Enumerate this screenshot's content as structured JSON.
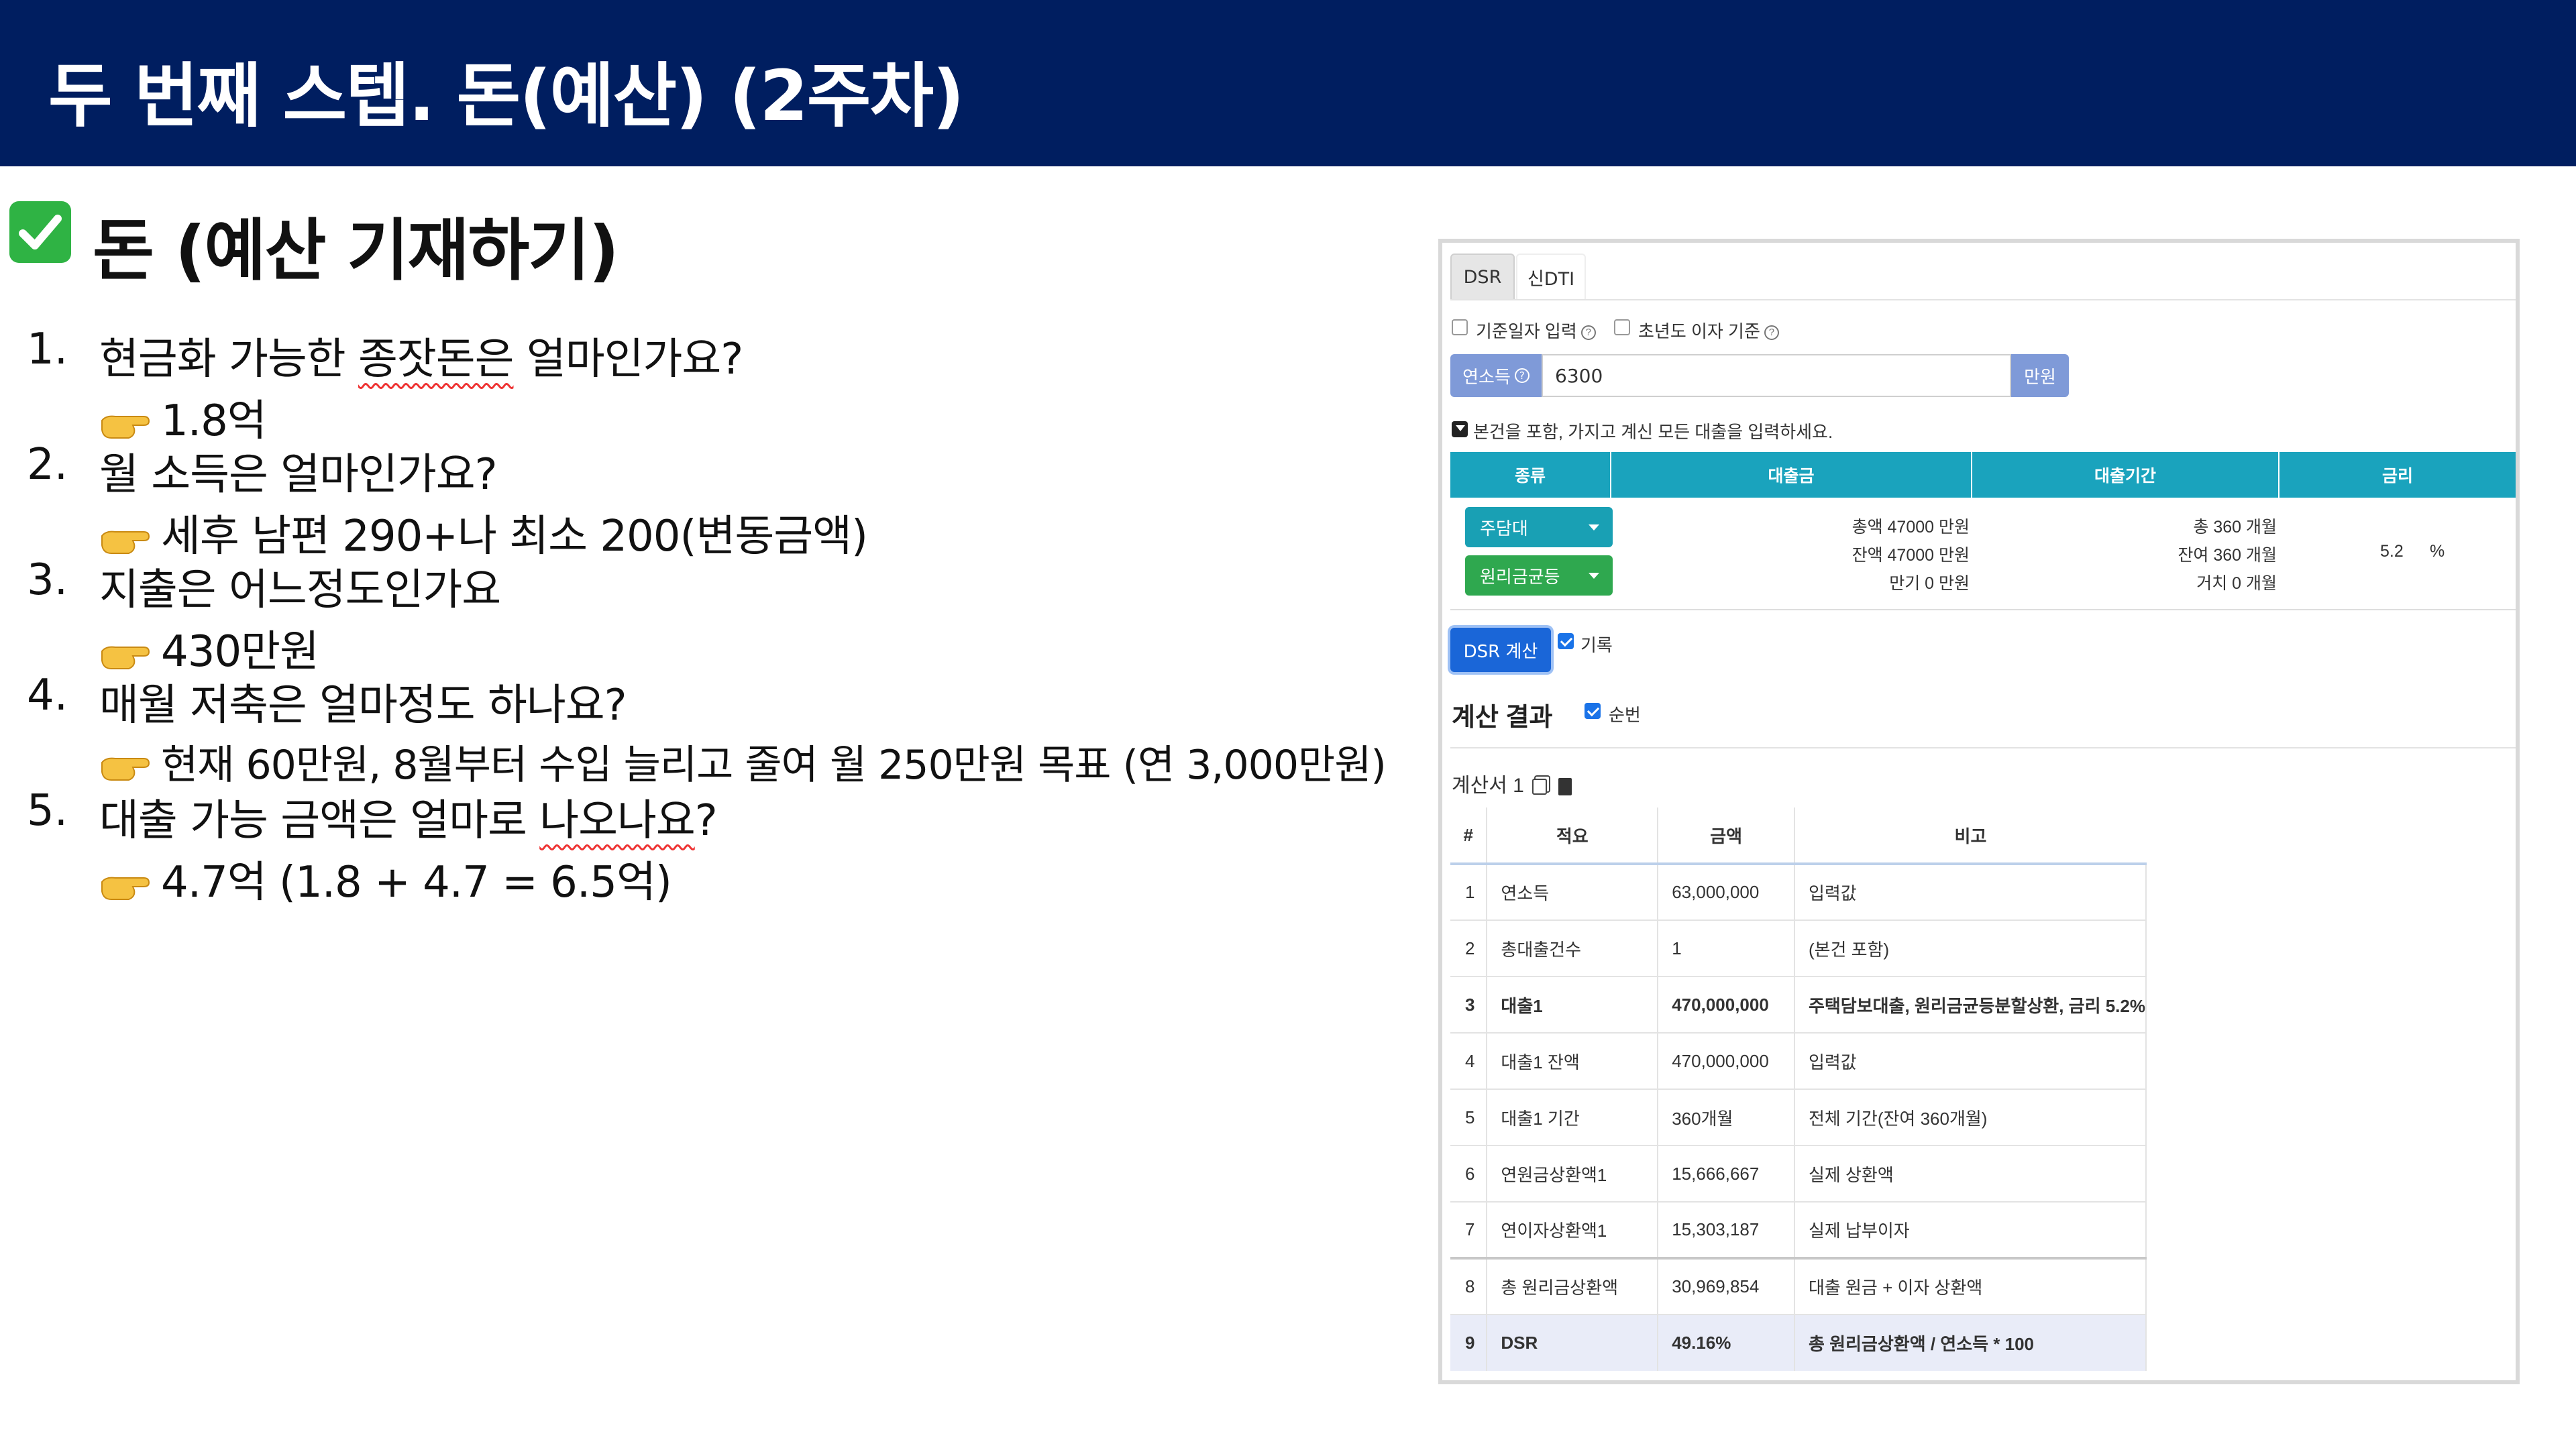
{
  "header": {
    "title": "두 번째 스텝. 돈(예산) (2주차)"
  },
  "section": {
    "title": "돈 (예산 기재하기)",
    "icon": "check-mark-icon"
  },
  "questions": [
    {
      "num": "1.",
      "text_before": "현금화 가능한 ",
      "text_underlined": "종잣돈은",
      "text_after": " 얼마인가요?",
      "answer": "1.8억"
    },
    {
      "num": "2.",
      "text_before": "월 소득은 얼마인가요?",
      "text_underlined": "",
      "text_after": "",
      "answer": "세후 남편 290+나 최소 200(변동금액)"
    },
    {
      "num": "3.",
      "text_before": "지출은 어느정도인가요",
      "text_underlined": "",
      "text_after": "",
      "answer": "430만원"
    },
    {
      "num": "4.",
      "text_before": "매월 저축은 얼마정도 하나요?",
      "text_underlined": "",
      "text_after": "",
      "answer": "현재 60만원, 8월부터 수입 늘리고 줄여 월 250만원 목표 (연 3,000만원)"
    },
    {
      "num": "5.",
      "text_before": "대출 가능 금액은 얼마로 ",
      "text_underlined": "나오나요",
      "text_after": "?",
      "answer": "4.7억 (1.8 + 4.7 = 6.5억)"
    }
  ],
  "calc": {
    "tabs": [
      "DSR",
      "신DTI"
    ],
    "options": {
      "base_date": "기준일자 입력",
      "first_year_interest": "초년도 이자 기준"
    },
    "income": {
      "label": "연소득",
      "value": "6300",
      "unit": "만원"
    },
    "notice": "본건을 포함, 가지고 계신 모든 대출을 입력하세요.",
    "loan_headers": [
      "종류",
      "대출금",
      "대출기간",
      "금리"
    ],
    "loan": {
      "type": "주담대",
      "repayment": "원리금균등",
      "amount_total": "총액 47000 만원",
      "amount_remain": "잔액 47000 만원",
      "amount_maturity": "만기 0 만원",
      "period_total": "총 360 개월",
      "period_remain": "잔여 360 개월",
      "period_grace": "거치 0 개월",
      "rate": "5.2",
      "rate_unit": "%"
    },
    "dsr_button": "DSR 계산",
    "record_label": "기록",
    "result_title": "계산 결과",
    "order_label": "순번",
    "sheet_label": "계산서 1",
    "result_headers": [
      "#",
      "적요",
      "금액",
      "비고"
    ],
    "rows": [
      [
        "1",
        "연소득",
        "63,000,000",
        "입력값"
      ],
      [
        "2",
        "총대출건수",
        "1",
        "(본건 포함)"
      ],
      [
        "3",
        "대출1",
        "470,000,000",
        "주택담보대출, 원리금균등분할상환, 금리 5.2%"
      ],
      [
        "4",
        "대출1 잔액",
        "470,000,000",
        "입력값"
      ],
      [
        "5",
        "대출1 기간",
        "360개월",
        "전체 기간(잔여 360개월)"
      ],
      [
        "6",
        "연원금상환액1",
        "15,666,667",
        "실제 상환액"
      ],
      [
        "7",
        "연이자상환액1",
        "15,303,187",
        "실제 납부이자"
      ],
      [
        "8",
        "총 원리금상환액",
        "30,969,854",
        "대출 원금 + 이자 상환액"
      ],
      [
        "9",
        "DSR",
        "49.16%",
        "총 원리금상환액 / 연소득 * 100"
      ]
    ]
  }
}
